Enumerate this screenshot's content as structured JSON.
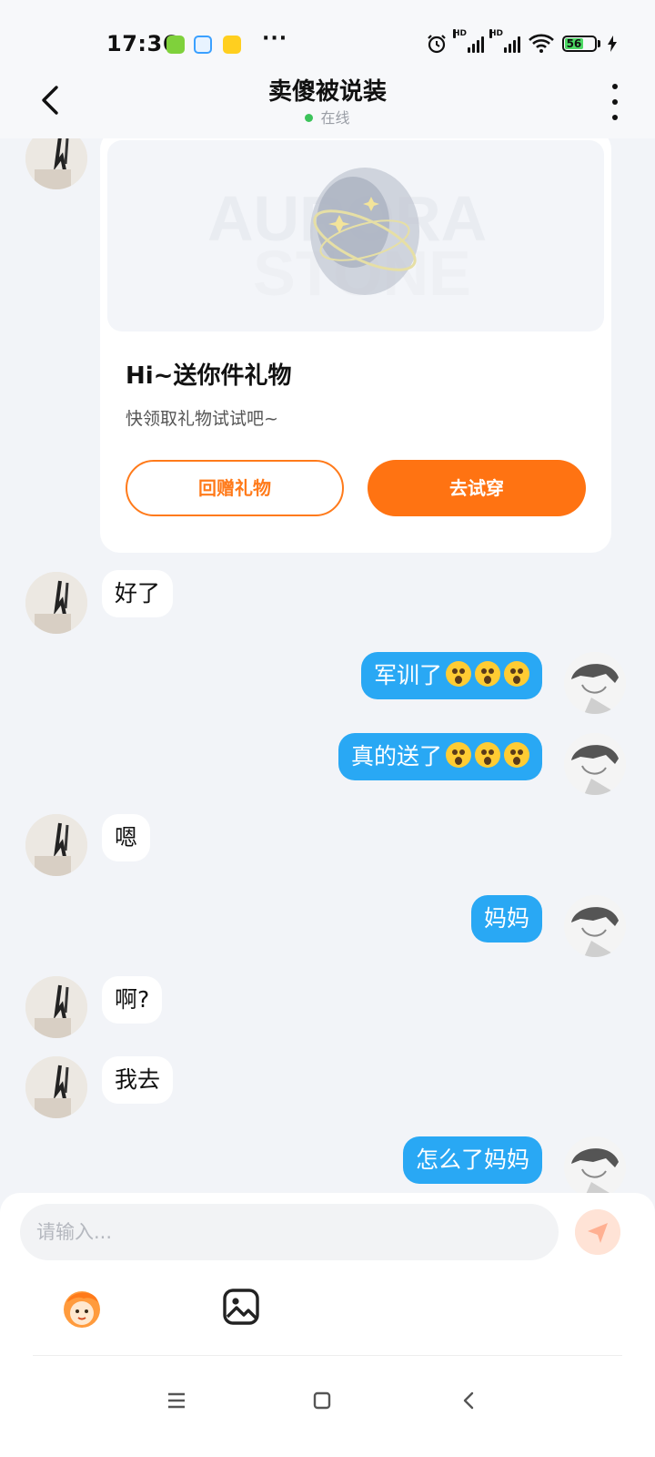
{
  "status_bar": {
    "time": "17:36",
    "signal1_label": "HD",
    "signal2_label": "HD",
    "battery_level": "56",
    "more_label": "···"
  },
  "header": {
    "title": "卖傻被说装",
    "status": "在线"
  },
  "gift_card": {
    "title": "Hi~送你件礼物",
    "subtitle": "快领取礼物试试吧~",
    "return_button": "回赠礼物",
    "try_button": "去试穿"
  },
  "messages": [
    {
      "from": "her",
      "text": "好了"
    },
    {
      "from": "me",
      "text": "军训了",
      "emoji_count": 3
    },
    {
      "from": "me",
      "text": "真的送了",
      "emoji_count": 3
    },
    {
      "from": "her",
      "text": "嗯"
    },
    {
      "from": "me",
      "text": "妈妈"
    },
    {
      "from": "her",
      "text": "啊?"
    },
    {
      "from": "her",
      "text": "我去"
    },
    {
      "from": "me",
      "text": "怎么了妈妈"
    }
  ],
  "input": {
    "placeholder": "请输入..."
  },
  "colors": {
    "accent_orange": "#ff7312",
    "bubble_blue": "#29a8f4",
    "online_green": "#3cc35a"
  }
}
